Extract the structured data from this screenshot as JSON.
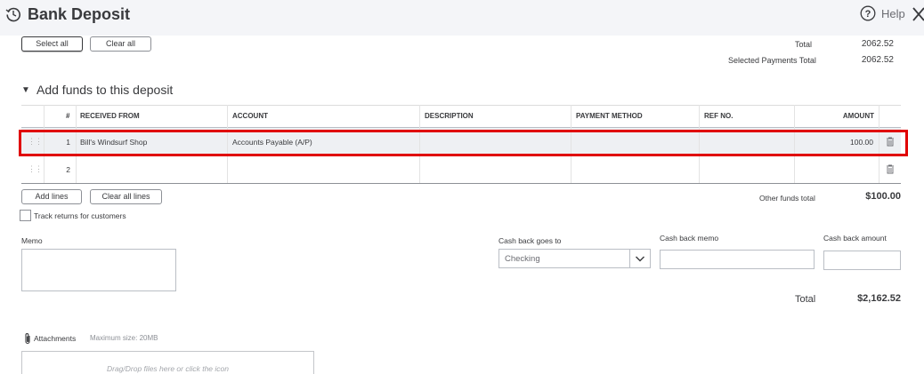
{
  "header": {
    "title": "Bank Deposit",
    "help_label": "Help"
  },
  "selection": {
    "select_all_label": "Select all",
    "clear_all_label": "Clear all",
    "total_label": "Total",
    "total_value": "2062.52",
    "selected_total_label": "Selected Payments Total",
    "selected_total_value": "2062.52"
  },
  "funds": {
    "section_title": "Add funds to this deposit",
    "columns": {
      "num": "#",
      "received_from": "RECEIVED FROM",
      "account": "ACCOUNT",
      "description": "DESCRIPTION",
      "payment_method": "PAYMENT METHOD",
      "ref_no": "REF NO.",
      "amount": "AMOUNT"
    },
    "rows": [
      {
        "num": "1",
        "received_from": "Bill's Windsurf Shop",
        "account": "Accounts Payable (A/P)",
        "description": "",
        "payment_method": "",
        "ref_no": "",
        "amount": "100.00"
      },
      {
        "num": "2",
        "received_from": "",
        "account": "",
        "description": "",
        "payment_method": "",
        "ref_no": "",
        "amount": ""
      }
    ],
    "add_lines_label": "Add lines",
    "clear_all_lines_label": "Clear all lines",
    "track_returns_label": "Track returns for customers",
    "other_funds_total_label": "Other funds total",
    "other_funds_total_value": "$100.00"
  },
  "memo": {
    "label": "Memo",
    "value": ""
  },
  "cash_back": {
    "goes_to_label": "Cash back goes to",
    "goes_to_value": "Checking",
    "memo_label": "Cash back memo",
    "memo_value": "",
    "amount_label": "Cash back amount",
    "amount_value": ""
  },
  "totals": {
    "total_label": "Total",
    "total_value": "$2,162.52"
  },
  "attachments": {
    "label": "Attachments",
    "max_size": "Maximum size: 20MB",
    "dropzone_text": "Drag/Drop files here or click the icon"
  },
  "colors": {
    "highlight": "#e00000",
    "header_bg": "#f4f5f8"
  }
}
